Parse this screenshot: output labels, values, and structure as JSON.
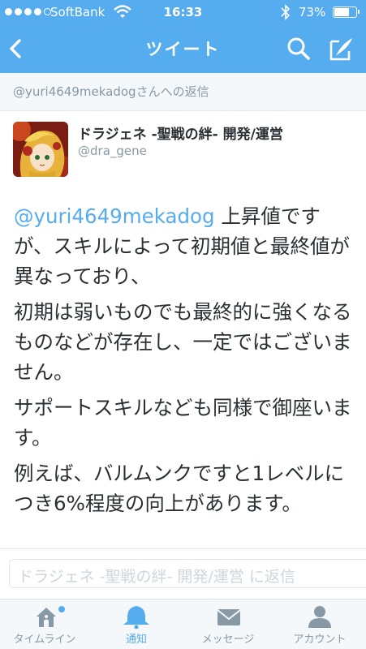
{
  "status_bar": {
    "carrier": "SoftBank",
    "time": "16:33",
    "battery": "73%",
    "battery_level": 0.73
  },
  "nav": {
    "title": "ツイート",
    "back_icon": "chevron-left-icon",
    "search_icon": "search-icon",
    "compose_icon": "compose-icon"
  },
  "reply_context": "@yuri4649mekadogさんへの返信",
  "tweet": {
    "author_name": "ドラジェネ -聖戦の絆- 開発/運営",
    "author_handle": "@dra_gene",
    "mention": "@yuri4649mekadog",
    "paragraphs": [
      " 上昇値ですが、スキルによって初期値と最終値が異なっており、",
      "初期は弱いものでも最終的に強くなるものなどが存在し、一定ではございません。",
      "サポートスキルなども同様で御座います。",
      "例えば、バルムンクですと1レベルにつき6%程度の向上があります。"
    ]
  },
  "reply_placeholder": "ドラジェネ -聖戦の絆- 開発/運営 に返信",
  "tabs": [
    {
      "label": "タイムライン",
      "icon": "home-icon",
      "active": false
    },
    {
      "label": "通知",
      "icon": "bell-icon",
      "active": true
    },
    {
      "label": "メッセージ",
      "icon": "envelope-icon",
      "active": false
    },
    {
      "label": "アカウント",
      "icon": "person-icon",
      "active": false
    }
  ],
  "colors": {
    "brand": "#55acee",
    "text": "#292f33",
    "muted": "#8899a6"
  }
}
